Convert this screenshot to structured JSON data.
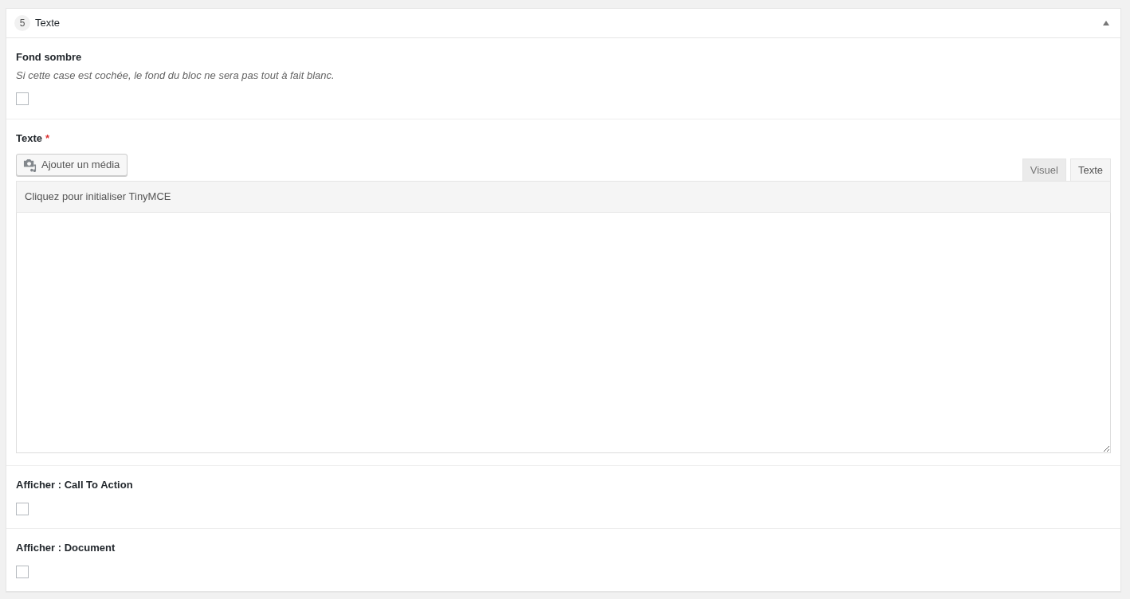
{
  "block": {
    "index": "5",
    "title": "Texte",
    "expanded": true
  },
  "fields": [
    {
      "kind": "checkbox",
      "label": "Fond sombre",
      "description": "Si cette case est cochée, le fond du bloc ne sera pas tout à fait blanc.",
      "checked": false
    },
    {
      "kind": "editor",
      "label": "Texte",
      "required_mark": "*",
      "media_button": "Ajouter un média",
      "tabs": [
        {
          "label": "Visuel",
          "selected": false
        },
        {
          "label": "Texte",
          "selected": true
        }
      ],
      "toolbar_hint": "Cliquez pour initialiser TinyMCE"
    },
    {
      "kind": "checkbox",
      "label": "Afficher : Call To Action",
      "checked": false
    },
    {
      "kind": "checkbox",
      "label": "Afficher : Document",
      "checked": false
    }
  ]
}
